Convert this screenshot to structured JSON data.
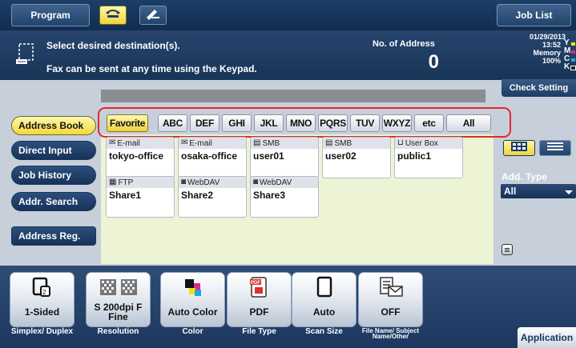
{
  "header": {
    "program_label": "Program",
    "job_list_label": "Job List",
    "icon_fax": "fax-icon",
    "icon_pen": "pen-icon"
  },
  "message": {
    "line1": "Select desired destination(s).",
    "line2": "Fax can be sent at any time using the Keypad.",
    "address_count_label": "No. of Address",
    "address_count": "0"
  },
  "status": {
    "date": "01/29/2013",
    "time": "13:52",
    "memory_label": "Memory",
    "memory_value": "100%",
    "toners": [
      {
        "letter": "Y",
        "color": "#f2e500"
      },
      {
        "letter": "M",
        "color": "#e0298a"
      },
      {
        "letter": "C",
        "color": "#2aa3e6"
      },
      {
        "letter": "K",
        "color": "#222222"
      }
    ],
    "check_setting_label": "Check Setting"
  },
  "nav": {
    "items": [
      {
        "label": "Address Book",
        "active": true
      },
      {
        "label": "Direct Input",
        "active": false
      },
      {
        "label": "Job History",
        "active": false
      },
      {
        "label": "Addr. Search",
        "active": false
      },
      {
        "label": "Address Reg.",
        "active": false
      }
    ]
  },
  "index_tabs": [
    "Favorite",
    "ABC",
    "DEF",
    "GHI",
    "JKL",
    "MNO",
    "PQRS",
    "TUV",
    "WXYZ",
    "etc",
    "All"
  ],
  "destinations": [
    {
      "type": "E-mail",
      "name": "tokyo-office",
      "icon": "email-icon"
    },
    {
      "type": "E-mail",
      "name": "osaka-office",
      "icon": "email-icon"
    },
    {
      "type": "SMB",
      "name": "user01",
      "icon": "smb-icon"
    },
    {
      "type": "SMB",
      "name": "user02",
      "icon": "smb-icon"
    },
    {
      "type": "User Box",
      "name": "public1",
      "icon": "userbox-icon"
    },
    {
      "type": "FTP",
      "name": "Share1",
      "icon": "ftp-icon"
    },
    {
      "type": "WebDAV",
      "name": "Share2",
      "icon": "webdav-icon"
    },
    {
      "type": "WebDAV",
      "name": "Share3",
      "icon": "webdav-icon"
    }
  ],
  "right_panel": {
    "add_type_label": "Add. Type",
    "add_type_value": "All"
  },
  "settings": [
    {
      "value": "1-Sided",
      "label": "Simplex/ Duplex",
      "icon": "simplex-icon"
    },
    {
      "value": "S 200dpi F Fine",
      "label": "Resolution",
      "icon": "resolution-icon"
    },
    {
      "value": "Auto Color",
      "label": "Color",
      "icon": "color-icon"
    },
    {
      "value": "PDF",
      "label": "File Type",
      "icon": "pdf-icon"
    },
    {
      "value": "Auto",
      "label": "Scan Size",
      "icon": "page-icon"
    },
    {
      "value": "OFF",
      "label": "File Name/ Subject Name/Other",
      "icon": "file-name-icon"
    }
  ],
  "application_label": "Application"
}
